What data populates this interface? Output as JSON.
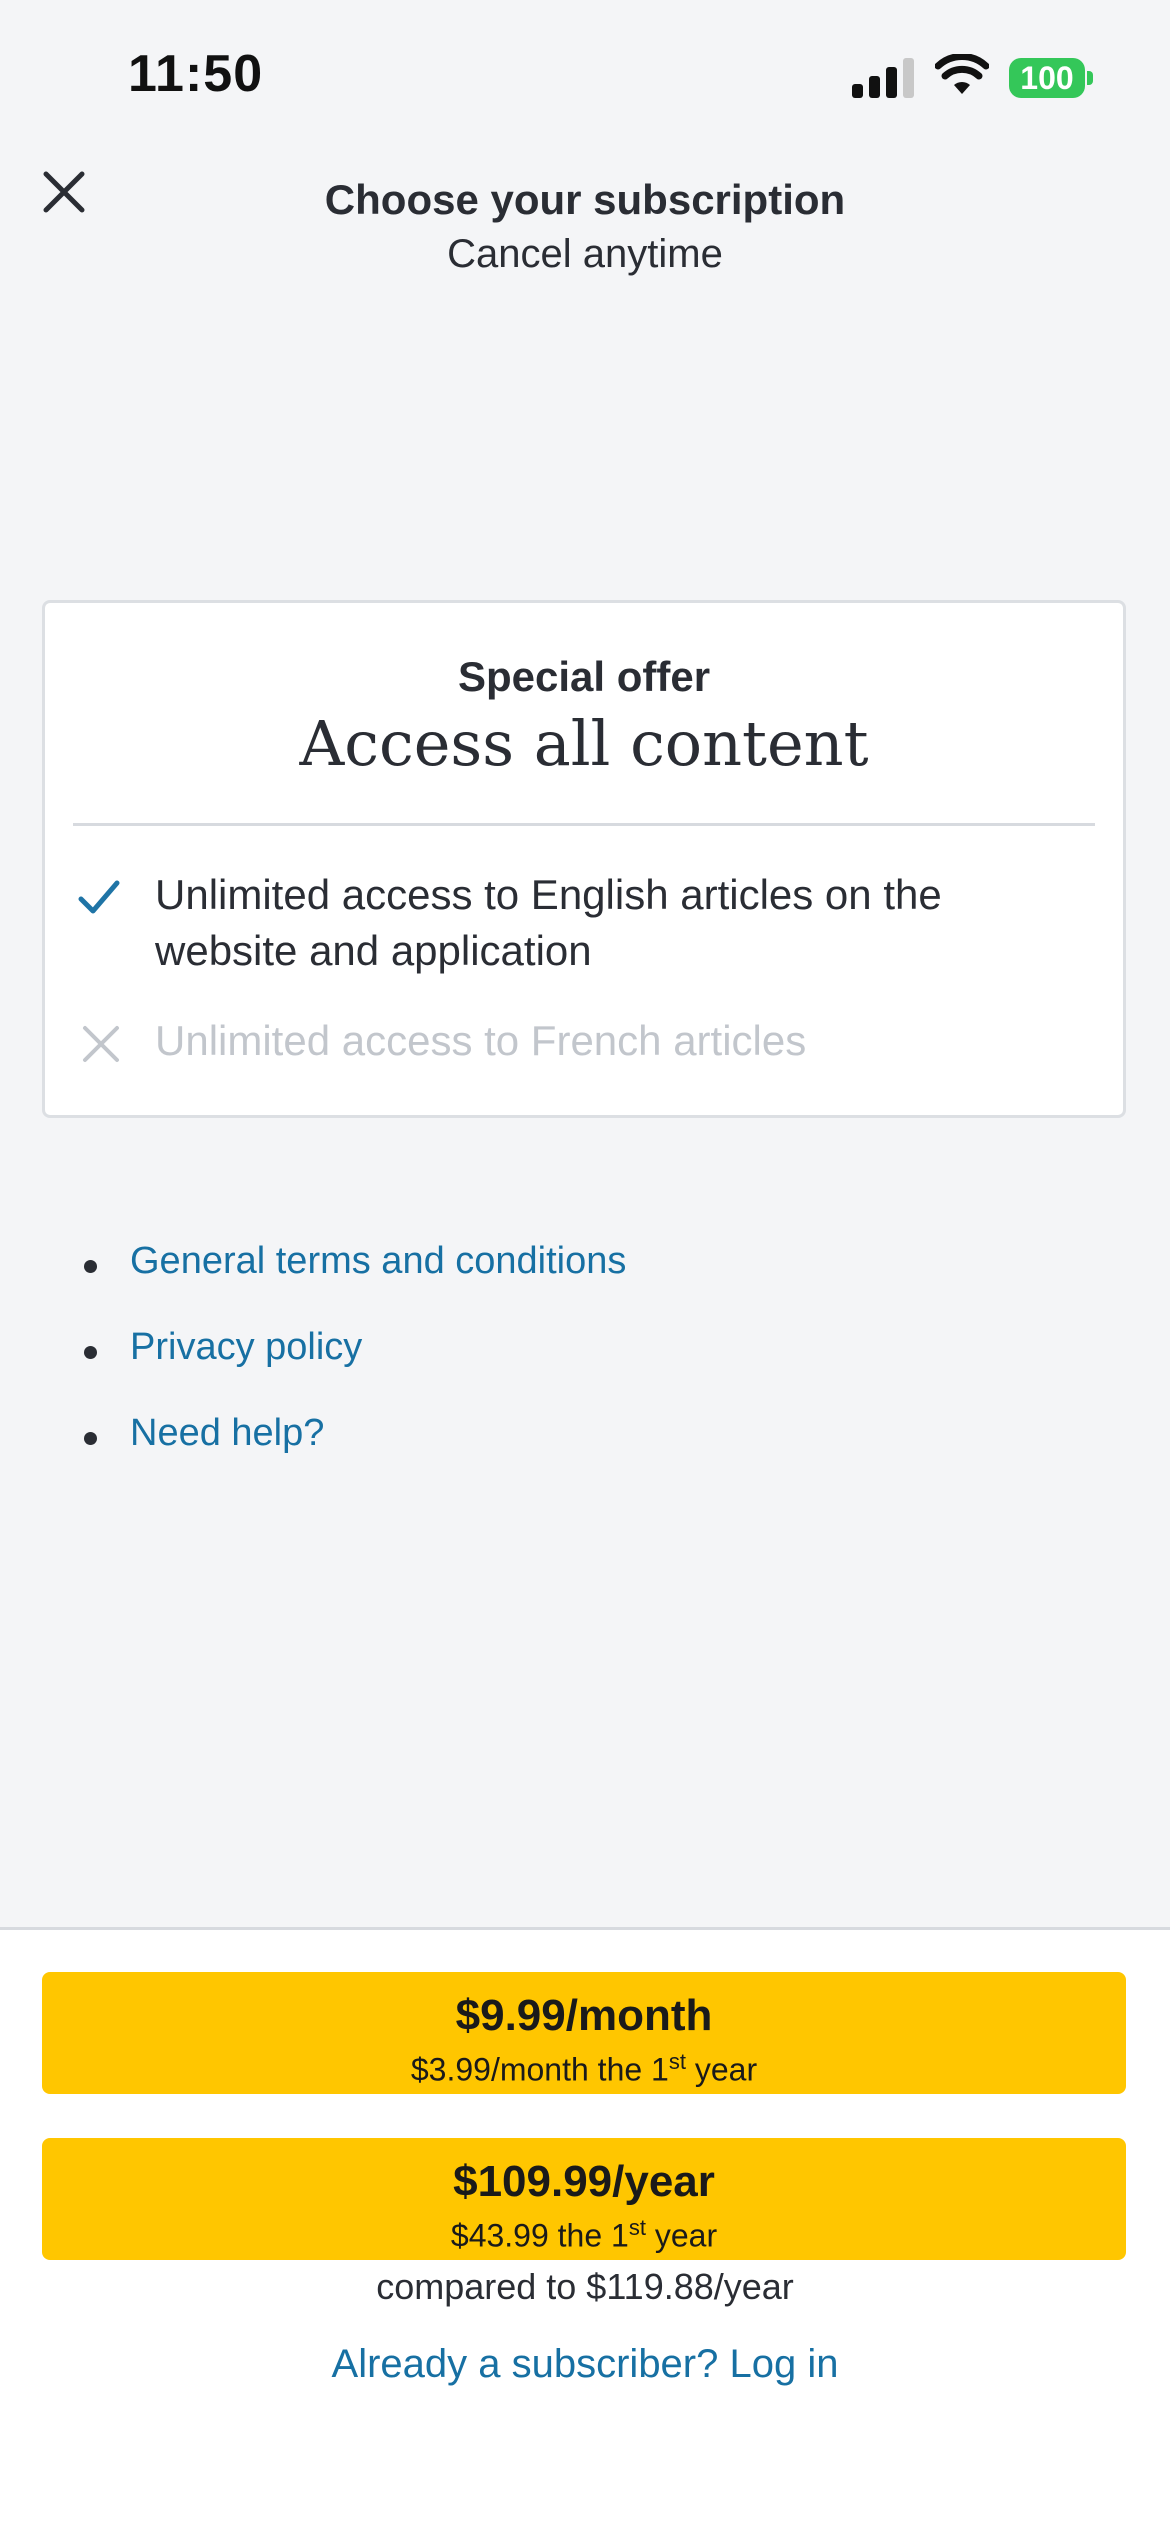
{
  "status_bar": {
    "time": "11:50",
    "battery": "100",
    "icons": [
      "cellular-signal-icon",
      "wifi-icon",
      "battery-icon"
    ]
  },
  "header": {
    "close_icon": "close-icon",
    "title": "Choose your subscription",
    "subtitle": "Cancel anytime"
  },
  "offer": {
    "label": "Special offer",
    "title": "Access all content",
    "features": [
      {
        "text": "Unlimited access to English articles on the website and application",
        "icon": "check-icon",
        "included": true
      },
      {
        "text": "Unlimited access to French articles",
        "icon": "x-icon",
        "included": false
      }
    ]
  },
  "links": [
    {
      "label": "General terms and conditions"
    },
    {
      "label": "Privacy policy"
    },
    {
      "label": "Need help?"
    }
  ],
  "plans": {
    "monthly": {
      "price": "$9.99/month",
      "note_prefix": "$3.99/month the 1",
      "note_sup": "st",
      "note_suffix": " year"
    },
    "yearly": {
      "price": "$109.99/year",
      "note_prefix": "$43.99 the 1",
      "note_sup": "st",
      "note_suffix": " year"
    },
    "compare": "compared to $119.88/year"
  },
  "login_link": "Already a subscriber? Log in",
  "colors": {
    "accent_yellow": "#ffc600",
    "link_blue": "#1770a3",
    "check_blue": "#1f74a6",
    "battery_green": "#34c759",
    "background": "#f4f5f7"
  }
}
